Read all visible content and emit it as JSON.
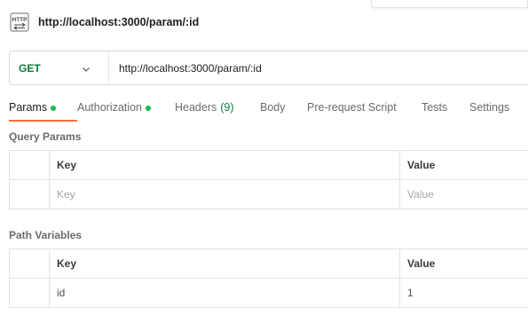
{
  "request": {
    "title": "http://localhost:3000/param/:id",
    "icon": "http-icon",
    "method": "GET",
    "url": "http://localhost:3000/param/:id"
  },
  "tabs": [
    {
      "label": "Params",
      "dot": true,
      "active": true
    },
    {
      "label": "Authorization",
      "dot": true
    },
    {
      "label": "Headers",
      "count": "(9)"
    },
    {
      "label": "Body"
    },
    {
      "label": "Pre-request Script"
    },
    {
      "label": "Tests"
    },
    {
      "label": "Settings"
    }
  ],
  "query_params": {
    "label": "Query Params",
    "headers": {
      "key": "Key",
      "value": "Value"
    },
    "placeholder": {
      "key": "Key",
      "value": "Value"
    }
  },
  "path_variables": {
    "label": "Path Variables",
    "headers": {
      "key": "Key",
      "value": "Value"
    },
    "rows": [
      {
        "key": "id",
        "value": "1"
      }
    ]
  },
  "colors": {
    "method": "#0b7a3b",
    "active_tab_underline": "#ff6c37",
    "status_dot": "#0cbb52"
  }
}
